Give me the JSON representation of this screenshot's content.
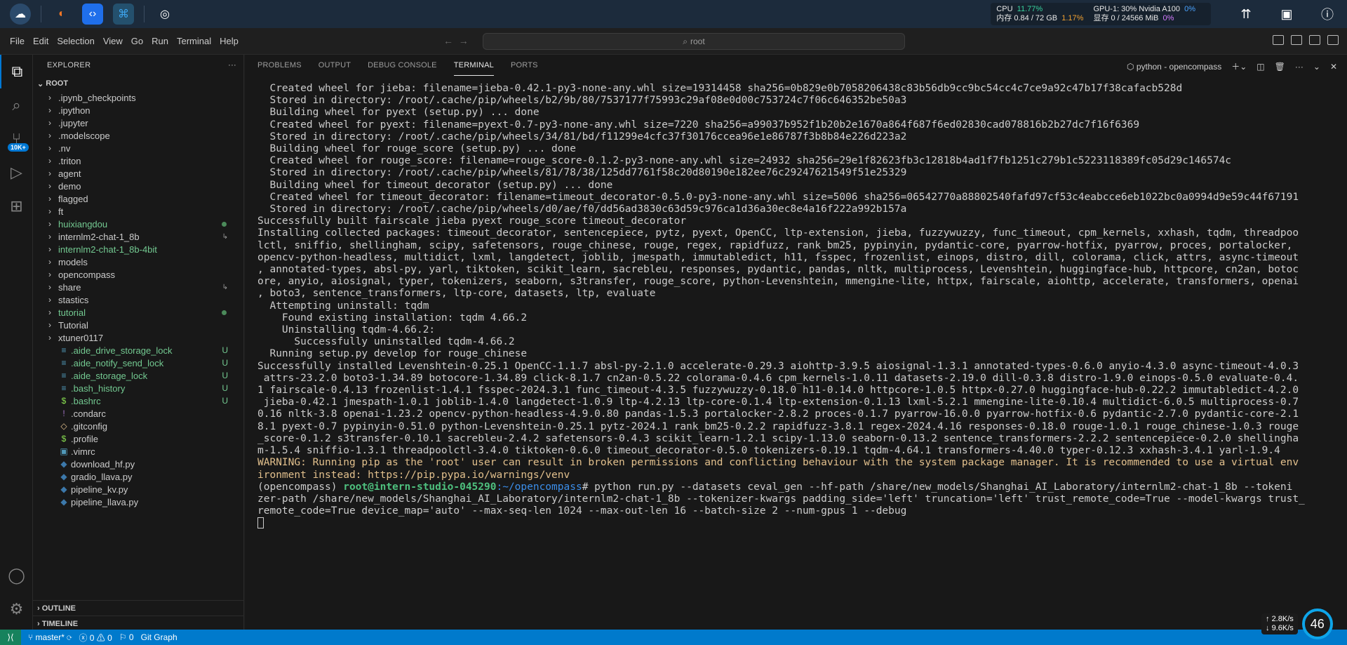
{
  "sysbar": {
    "cpu_label": "CPU",
    "cpu_value": "11.77%",
    "mem_label": "内存 0.84 / 72 GB",
    "mem_value": "1.17%",
    "gpu_label": "GPU-1: 30% Nvidia A100",
    "gpu_value": "0%",
    "vram_label": "显存 0 / 24566 MiB",
    "vram_value": "0%"
  },
  "menu": {
    "items": [
      "File",
      "Edit",
      "Selection",
      "View",
      "Go",
      "Run",
      "Terminal",
      "Help"
    ],
    "search": "root"
  },
  "activity": {
    "scm_badge": "10K+"
  },
  "sidebar": {
    "title": "EXPLORER",
    "root": "ROOT",
    "items": [
      {
        "name": ".ipynb_checkpoints",
        "type": "folder"
      },
      {
        "name": ".ipython",
        "type": "folder"
      },
      {
        "name": ".jupyter",
        "type": "folder"
      },
      {
        "name": ".modelscope",
        "type": "folder"
      },
      {
        "name": ".nv",
        "type": "folder"
      },
      {
        "name": ".triton",
        "type": "folder"
      },
      {
        "name": "agent",
        "type": "folder"
      },
      {
        "name": "demo",
        "type": "folder"
      },
      {
        "name": "flagged",
        "type": "folder"
      },
      {
        "name": "ft",
        "type": "folder"
      },
      {
        "name": "huixiangdou",
        "type": "folder"
      },
      {
        "name": "internlm2-chat-1_8b",
        "type": "folder"
      },
      {
        "name": "internlm2-chat-1_8b-4bit",
        "type": "folder"
      },
      {
        "name": "models",
        "type": "folder"
      },
      {
        "name": "opencompass",
        "type": "folder"
      },
      {
        "name": "share",
        "type": "folder"
      },
      {
        "name": "stastics",
        "type": "folder"
      },
      {
        "name": "tutorial",
        "type": "folder"
      },
      {
        "name": "Tutorial",
        "type": "folder"
      },
      {
        "name": "xtuner0117",
        "type": "folder"
      },
      {
        "name": ".aide_drive_storage_lock",
        "type": "file",
        "mark": "U"
      },
      {
        "name": ".aide_notify_send_lock",
        "type": "file",
        "mark": "U"
      },
      {
        "name": ".aide_storage_lock",
        "type": "file",
        "mark": "U"
      },
      {
        "name": ".bash_history",
        "type": "file",
        "mark": "U"
      },
      {
        "name": ".bashrc",
        "type": "file",
        "mark": "U"
      },
      {
        "name": ".condarc",
        "type": "file"
      },
      {
        "name": ".gitconfig",
        "type": "file"
      },
      {
        "name": ".profile",
        "type": "file"
      },
      {
        "name": ".vimrc",
        "type": "file"
      },
      {
        "name": "download_hf.py",
        "type": "file"
      },
      {
        "name": "gradio_llava.py",
        "type": "file"
      },
      {
        "name": "pipeline_kv.py",
        "type": "file"
      },
      {
        "name": "pipeline_llava.py",
        "type": "file"
      }
    ],
    "outline": "OUTLINE",
    "timeline": "TIMELINE"
  },
  "panel": {
    "tabs": [
      "PROBLEMS",
      "OUTPUT",
      "DEBUG CONSOLE",
      "TERMINAL",
      "PORTS"
    ],
    "active_tab": "TERMINAL",
    "terminal_name": "python - opencompass",
    "lines": [
      "  Created wheel for jieba: filename=jieba-0.42.1-py3-none-any.whl size=19314458 sha256=0b829e0b7058206438c83b56db9cc9bc54cc4c7ce9a92c47b17f38cafacb528d",
      "  Stored in directory: /root/.cache/pip/wheels/b2/9b/80/7537177f75993c29af08e0d00c753724c7f06c646352be50a3",
      "  Building wheel for pyext (setup.py) ... done",
      "  Created wheel for pyext: filename=pyext-0.7-py3-none-any.whl size=7220 sha256=a99037b952f1b20b2e1670a864f687f6ed02830cad078816b2b27dc7f16f6369",
      "  Stored in directory: /root/.cache/pip/wheels/34/81/bd/f11299e4cfc37f30176ccea96e1e86787f3b8b84e226d223a2",
      "  Building wheel for rouge_score (setup.py) ... done",
      "  Created wheel for rouge_score: filename=rouge_score-0.1.2-py3-none-any.whl size=24932 sha256=29e1f82623fb3c12818b4ad1f7fb1251c279b1c5223118389fc05d29c146574c",
      "  Stored in directory: /root/.cache/pip/wheels/81/78/38/125dd7761f58c20d80190e182ee76c29247621549f51e25329",
      "  Building wheel for timeout_decorator (setup.py) ... done",
      "  Created wheel for timeout_decorator: filename=timeout_decorator-0.5.0-py3-none-any.whl size=5006 sha256=06542770a88802540fafd97cf53c4eabcce6eb1022bc0a0994d9e59c44f67191",
      "  Stored in directory: /root/.cache/pip/wheels/d0/ae/f0/dd56ad3830c63d59c976ca1d36a30ec8e4a16f222a992b157a",
      "Successfully built fairscale jieba pyext rouge_score timeout_decorator",
      "Installing collected packages: timeout_decorator, sentencepiece, pytz, pyext, OpenCC, ltp-extension, jieba, fuzzywuzzy, func_timeout, cpm_kernels, xxhash, tqdm, threadpoo",
      "lctl, sniffio, shellingham, scipy, safetensors, rouge_chinese, rouge, regex, rapidfuzz, rank_bm25, pypinyin, pydantic-core, pyarrow-hotfix, pyarrow, proces, portalocker, ",
      "opencv-python-headless, multidict, lxml, langdetect, joblib, jmespath, immutabledict, h11, fsspec, frozenlist, einops, distro, dill, colorama, click, attrs, async-timeout",
      ", annotated-types, absl-py, yarl, tiktoken, scikit_learn, sacrebleu, responses, pydantic, pandas, nltk, multiprocess, Levenshtein, huggingface-hub, httpcore, cn2an, botoc",
      "ore, anyio, aiosignal, typer, tokenizers, seaborn, s3transfer, rouge_score, python-Levenshtein, mmengine-lite, httpx, fairscale, aiohttp, accelerate, transformers, openai",
      ", boto3, sentence_transformers, ltp-core, datasets, ltp, evaluate",
      "  Attempting uninstall: tqdm",
      "    Found existing installation: tqdm 4.66.2",
      "    Uninstalling tqdm-4.66.2:",
      "      Successfully uninstalled tqdm-4.66.2",
      "  Running setup.py develop for rouge_chinese",
      "Successfully installed Levenshtein-0.25.1 OpenCC-1.1.7 absl-py-2.1.0 accelerate-0.29.3 aiohttp-3.9.5 aiosignal-1.3.1 annotated-types-0.6.0 anyio-4.3.0 async-timeout-4.0.3",
      " attrs-23.2.0 boto3-1.34.89 botocore-1.34.89 click-8.1.7 cn2an-0.5.22 colorama-0.4.6 cpm_kernels-1.0.11 datasets-2.19.0 dill-0.3.8 distro-1.9.0 einops-0.5.0 evaluate-0.4.",
      "1 fairscale-0.4.13 frozenlist-1.4.1 fsspec-2024.3.1 func_timeout-4.3.5 fuzzywuzzy-0.18.0 h11-0.14.0 httpcore-1.0.5 httpx-0.27.0 huggingface-hub-0.22.2 immutabledict-4.2.0",
      " jieba-0.42.1 jmespath-1.0.1 joblib-1.4.0 langdetect-1.0.9 ltp-4.2.13 ltp-core-0.1.4 ltp-extension-0.1.13 lxml-5.2.1 mmengine-lite-0.10.4 multidict-6.0.5 multiprocess-0.7",
      "0.16 nltk-3.8 openai-1.23.2 opencv-python-headless-4.9.0.80 pandas-1.5.3 portalocker-2.8.2 proces-0.1.7 pyarrow-16.0.0 pyarrow-hotfix-0.6 pydantic-2.7.0 pydantic-core-2.1",
      "8.1 pyext-0.7 pypinyin-0.51.0 python-Levenshtein-0.25.1 pytz-2024.1 rank_bm25-0.2.2 rapidfuzz-3.8.1 regex-2024.4.16 responses-0.18.0 rouge-1.0.1 rouge_chinese-1.0.3 rouge",
      "_score-0.1.2 s3transfer-0.10.1 sacrebleu-2.4.2 safetensors-0.4.3 scikit_learn-1.2.1 scipy-1.13.0 seaborn-0.13.2 sentence_transformers-2.2.2 sentencepiece-0.2.0 shellingha",
      "m-1.5.4 sniffio-1.3.1 threadpoolctl-3.4.0 tiktoken-0.6.0 timeout_decorator-0.5.0 tokenizers-0.19.1 tqdm-4.64.1 transformers-4.40.0 typer-0.12.3 xxhash-3.4.1 yarl-1.9.4"
    ],
    "warning_lines": [
      "WARNING: Running pip as the 'root' user can result in broken permissions and conflicting behaviour with the system package manager. It is recommended to use a virtual env",
      "ironment instead: https://pip.pypa.io/warnings/venv"
    ],
    "prompt_env": "(opencompass) ",
    "prompt_user": "root@intern-studio-045290",
    "prompt_path": ":~/opencompass",
    "prompt_cmd": "# python run.py --datasets ceval_gen --hf-path /share/new_models/Shanghai_AI_Laboratory/internlm2-chat-1_8b --tokeni",
    "cmd_cont": [
      "zer-path /share/new_models/Shanghai_AI_Laboratory/internlm2-chat-1_8b --tokenizer-kwargs padding_side='left' truncation='left' trust_remote_code=True --model-kwargs trust_",
      "remote_code=True device_map='auto' --max-seq-len 1024 --max-out-len 16 --batch-size 2 --num-gpus 1 --debug"
    ]
  },
  "statusbar": {
    "branch": "master*",
    "errors": "0",
    "warnings": "0",
    "ports": "0",
    "git_graph": "Git Graph"
  },
  "netwidget": {
    "up": "2.8K/s",
    "down": "9.6K/s",
    "percent": "46"
  }
}
